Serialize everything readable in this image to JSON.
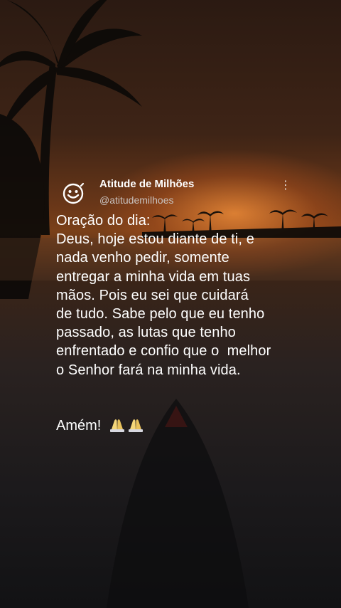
{
  "tweet": {
    "author_name": "Atitude de Milhões",
    "handle": "@atitudemilhoes",
    "avatar_icon": "smiley-face-icon",
    "more_icon": "more-vertical-icon"
  },
  "post": {
    "lines": [
      "Oração do dia:",
      "Deus, hoje estou diante de ti, e",
      "nada venho pedir, somente",
      "entregar a minha vida em tuas",
      "mãos. Pois eu sei que cuidará",
      "de tudo. Sabe pelo que eu tenho",
      "passado, as lutas que tenho",
      "enfrentado e confio que o  melhor",
      "o Senhor fará na minha vida."
    ],
    "closing": "Amém!",
    "closing_icon": "praying-hands-icon"
  },
  "colors": {
    "text": "#ffffff",
    "handle": "#c9c3c0",
    "sunset": "#ff9a3c"
  }
}
